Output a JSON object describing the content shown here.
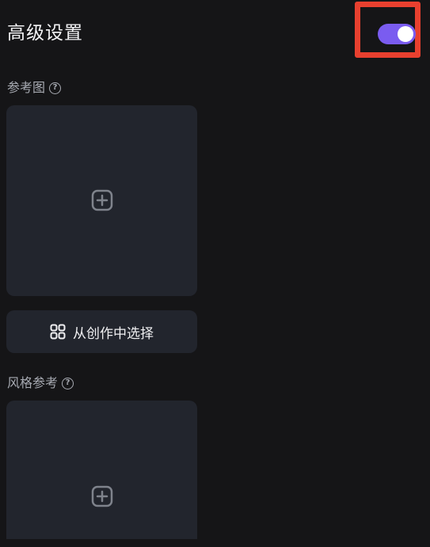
{
  "header": {
    "title": "高级设置",
    "toggle_on": true
  },
  "reference_image": {
    "label": "参考图",
    "help": "?"
  },
  "select_from_creations": {
    "label": "从创作中选择"
  },
  "style_reference": {
    "label": "风格参考",
    "help": "?"
  },
  "icons": {
    "upload": "plus-square-icon",
    "gallery": "grid-icon",
    "help": "question-circle-icon"
  },
  "colors": {
    "accent": "#7a5cf0",
    "highlight": "#e8402f",
    "background": "#151517",
    "card": "#22252d"
  }
}
